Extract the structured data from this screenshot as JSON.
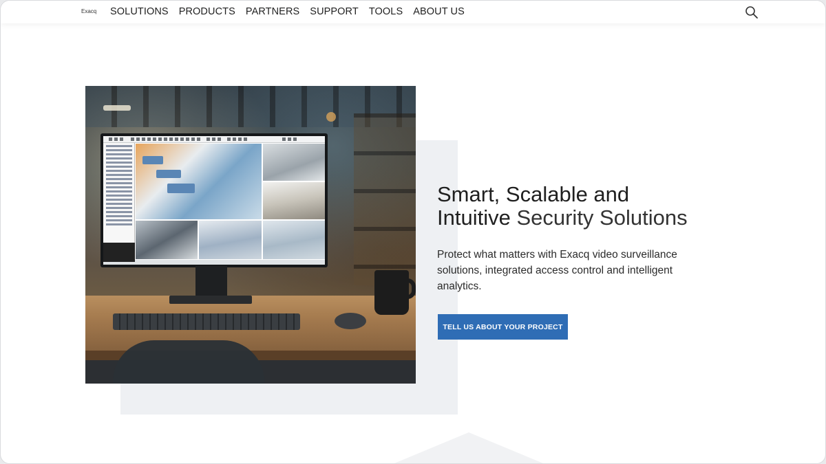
{
  "header": {
    "logo": "Exacq",
    "nav": [
      "SOLUTIONS",
      "PRODUCTS",
      "PARTNERS",
      "SUPPORT",
      "TOOLS",
      "ABOUT US"
    ]
  },
  "hero": {
    "headline_line1": "Smart, Scalable and",
    "headline_line2_a": "Intuitive ",
    "headline_line2_b": "Security Solutions",
    "body": "Protect what matters with Exacq video surveillance solutions, integrated access control and intelligent analytics.",
    "cta_label": "TELL US ABOUT YOUR PROJECT"
  },
  "colors": {
    "accent": "#2f6db5",
    "text": "#1f1f1f",
    "backplate": "#eef0f3"
  },
  "icons": {
    "search": "search-icon"
  }
}
